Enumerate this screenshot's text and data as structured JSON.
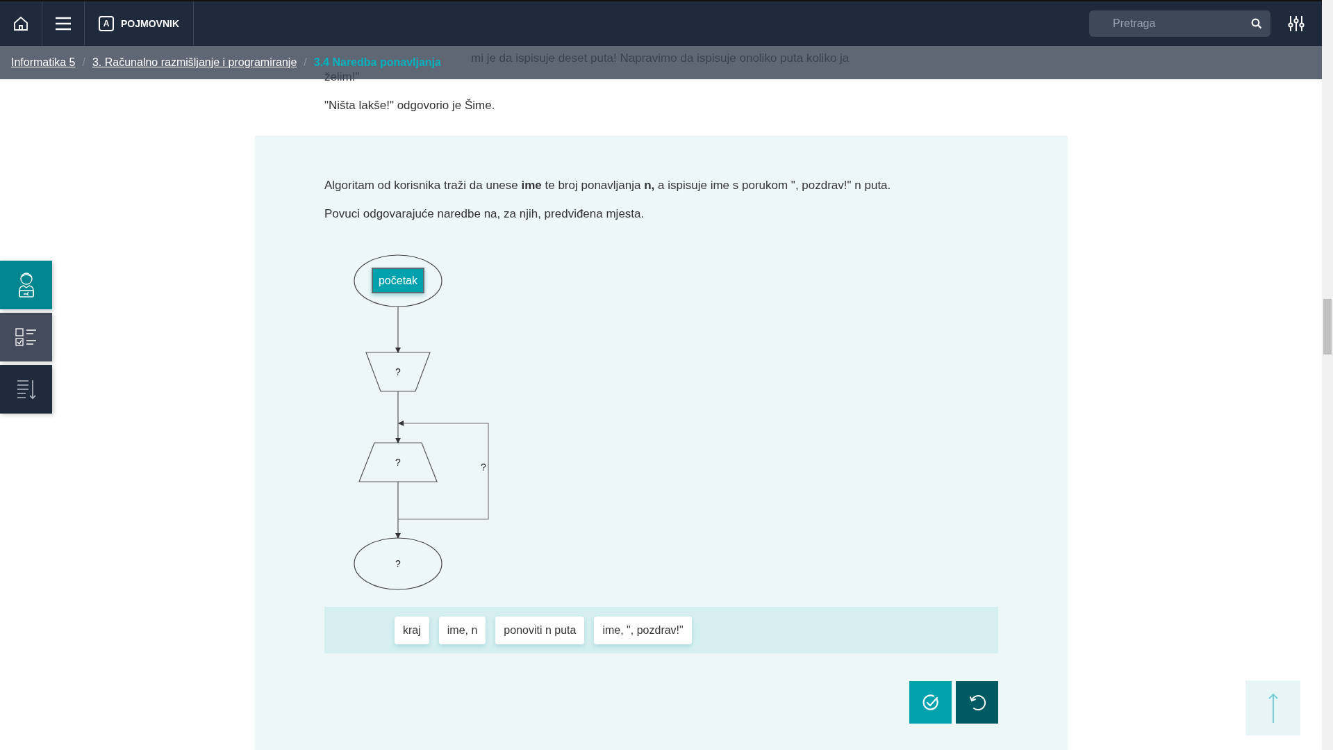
{
  "header": {
    "glossary_badge": "A",
    "glossary_label": "POJMOVNIK",
    "search": {
      "placeholder": "Pretraga"
    }
  },
  "breadcrumb": {
    "separator": "/",
    "items": [
      {
        "label": "Informatika 5",
        "current": false
      },
      {
        "label": "3. Računalno razmišljanje i programiranje",
        "current": false
      },
      {
        "label": "3.4 Naredba ponavljanja",
        "current": true
      }
    ]
  },
  "side_tabs": [
    {
      "kind": "student",
      "selected": true
    },
    {
      "kind": "checklist",
      "selected": false
    },
    {
      "kind": "outline",
      "selected": false
    }
  ],
  "intro": [
    "mi je da ispisuje deset puta! Napravimo da ispisuje onoliko puta koliko ja",
    "želim!\"",
    "\"Ništa lakše!\" odgovorio je Šime."
  ],
  "exercise": {
    "instructions": [
      "Algoritam od korisnika traži da unese **ime** te broj ponavljanja **n,** a ispisuje ime s porukom \", pozdrav!\" n puta.",
      "Povuci odgovarajuće naredbe na, za njih, predviđena mjesta."
    ],
    "flowchart": {
      "nodes": [
        {
          "kind": "terminal",
          "label": "početak",
          "filled": true
        },
        {
          "kind": "input",
          "label": "?",
          "filled": false
        },
        {
          "kind": "output",
          "label": "?",
          "filled": false
        },
        {
          "kind": "terminal",
          "label": "?",
          "filled": false
        }
      ],
      "loop_label": "?"
    },
    "answers": [
      "kraj",
      "ime, n",
      "ponoviti n puta",
      "ime, \", pozdrav!\""
    ]
  }
}
